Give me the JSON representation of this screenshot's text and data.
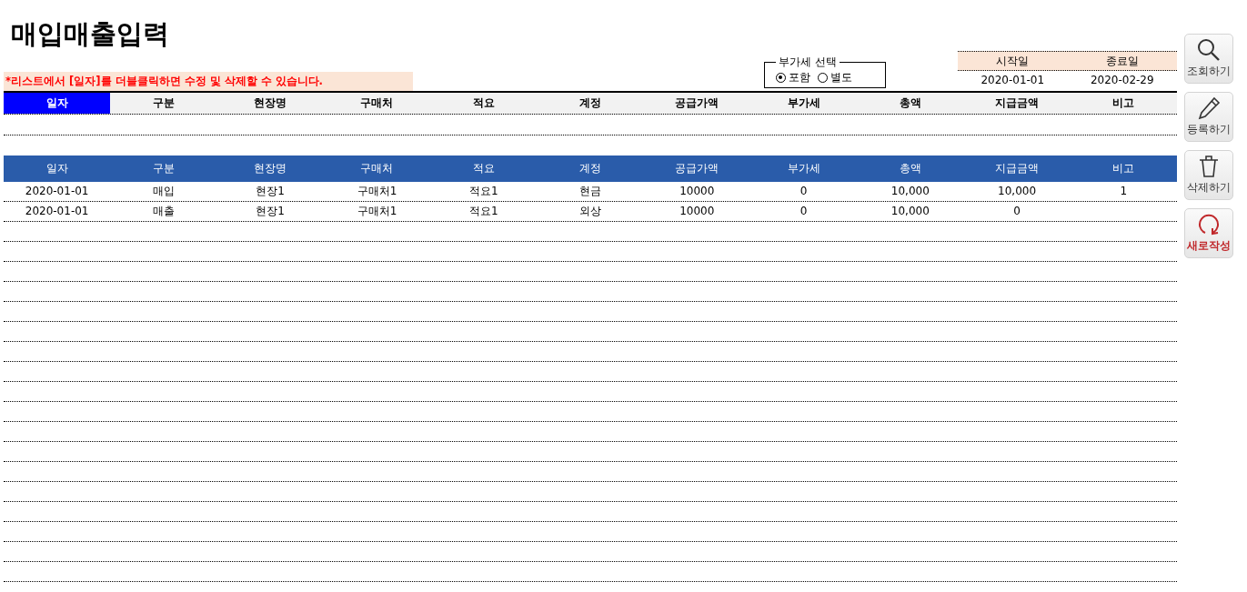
{
  "title": "매입매출입력",
  "hint": "*리스트에서 [일자]를 더블클릭하면 수정 및 삭제할 수 있습니다.",
  "vat": {
    "legend": "부가세 선택",
    "options": [
      {
        "label": "포함",
        "selected": true
      },
      {
        "label": "별도",
        "selected": false
      }
    ]
  },
  "date_range": {
    "columns": [
      "시작일",
      "종료일"
    ],
    "values": [
      "2020-01-01",
      "2020-02-29"
    ]
  },
  "filter_header": [
    {
      "label": "일자",
      "selected": true
    },
    {
      "label": "구분",
      "selected": false
    },
    {
      "label": "현장명",
      "selected": false
    },
    {
      "label": "구매처",
      "selected": false
    },
    {
      "label": "적요",
      "selected": false
    },
    {
      "label": "계정",
      "selected": false
    },
    {
      "label": "공급가액",
      "selected": false
    },
    {
      "label": "부가세",
      "selected": false
    },
    {
      "label": "총액",
      "selected": false
    },
    {
      "label": "지급금액",
      "selected": false
    },
    {
      "label": "비고",
      "selected": false
    }
  ],
  "table": {
    "columns": [
      "일자",
      "구분",
      "현장명",
      "구매처",
      "적요",
      "계정",
      "공급가액",
      "부가세",
      "총액",
      "지급금액",
      "비고"
    ],
    "rows": [
      [
        "2020-01-01",
        "매입",
        "현장1",
        "구매처1",
        "적요1",
        "현금",
        "10000",
        "0",
        "10,000",
        "10,000",
        "1"
      ],
      [
        "2020-01-01",
        "매출",
        "현장1",
        "구매처1",
        "적요1",
        "외상",
        "10000",
        "0",
        "10,000",
        "0",
        ""
      ]
    ]
  },
  "buttons": [
    {
      "kind": "search",
      "label": "조회하기"
    },
    {
      "kind": "edit",
      "label": "등록하기"
    },
    {
      "kind": "delete",
      "label": "삭제하기"
    },
    {
      "kind": "new",
      "label": "새로작성"
    }
  ]
}
